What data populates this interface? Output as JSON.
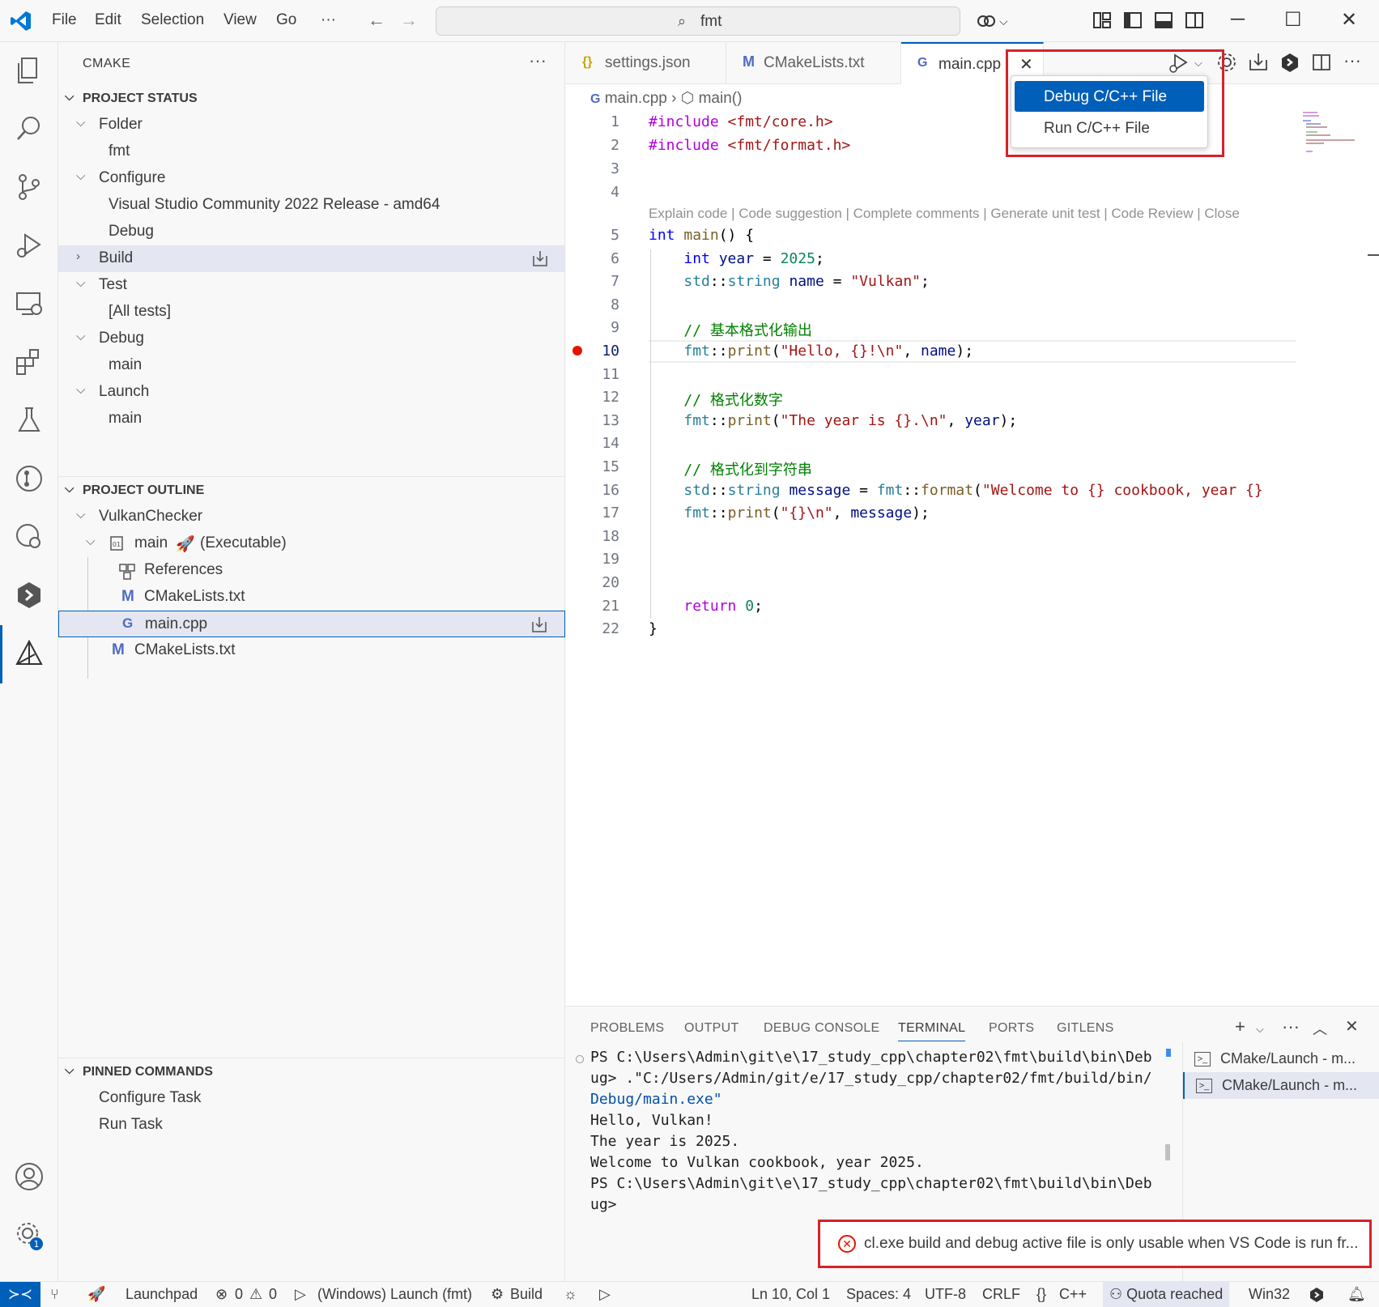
{
  "titlebar": {
    "menus": [
      "File",
      "Edit",
      "Selection",
      "View",
      "Go",
      "···"
    ],
    "search_text": "fmt"
  },
  "sidebar": {
    "title": "CMAKE",
    "project_status": {
      "header": "PROJECT STATUS",
      "rows": [
        "Folder",
        "fmt",
        "Configure",
        "Visual Studio Community 2022 Release - amd64",
        "Debug",
        "Build",
        "Test",
        "[All tests]",
        "Debug",
        "main",
        "Launch",
        "main"
      ]
    },
    "project_outline": {
      "header": "PROJECT OUTLINE",
      "rows": [
        "VulkanChecker",
        "main",
        "(Executable)",
        "References",
        "CMakeLists.txt",
        "main.cpp",
        "CMakeLists.txt"
      ]
    },
    "pinned_commands": {
      "header": "PINNED COMMANDS",
      "rows": [
        "Configure Task",
        "Run Task"
      ]
    }
  },
  "tabs": [
    {
      "label": "settings.json",
      "icon": "{}"
    },
    {
      "label": "CMakeLists.txt",
      "icon": "M"
    },
    {
      "label": "main.cpp",
      "icon": "G"
    }
  ],
  "editor": {
    "breadcrumb": [
      "main.cpp",
      "main()"
    ],
    "codelens": "Explain code | Code suggestion | Complete comments | Generate unit test | Code Review | Close",
    "line_numbers": [
      "1",
      "2",
      "3",
      "4",
      "5",
      "6",
      "7",
      "8",
      "9",
      "10",
      "11",
      "12",
      "13",
      "14",
      "15",
      "16",
      "17",
      "18",
      "19",
      "20",
      "21",
      "22"
    ],
    "current_line": "10"
  },
  "run_menu": {
    "items": [
      "Debug C/C++ File",
      "Run C/C++ File"
    ]
  },
  "panel": {
    "tabs": [
      "PROBLEMS",
      "OUTPUT",
      "DEBUG CONSOLE",
      "TERMINAL",
      "PORTS",
      "GITLENS"
    ],
    "terminal_lines": [
      "PS C:\\Users\\Admin\\git\\e\\17_study_cpp\\chapter02\\fmt\\build\\bin\\Deb",
      "ug> .\"C:/Users/Admin/git/e/17_study_cpp/chapter02/fmt/build/bin/",
      "Debug/main.exe\"",
      "Hello, Vulkan!",
      "The year is 2025.",
      "Welcome to Vulkan cookbook, year 2025.",
      "PS C:\\Users\\Admin\\git\\e\\17_study_cpp\\chapter02\\fmt\\build\\bin\\Deb",
      "ug>"
    ],
    "terminals": [
      "CMake/Launch - m...",
      "CMake/Launch - m..."
    ]
  },
  "notification": {
    "text": "cl.exe build and debug active file is only usable when VS Code is run fr..."
  },
  "statusbar": {
    "launchpad": "Launchpad",
    "errors": "0",
    "warnings": "0",
    "launch": "(Windows) Launch (fmt)",
    "build": "Build",
    "position": "Ln 10, Col 1",
    "spaces": "Spaces: 4",
    "encoding": "UTF-8",
    "eol": "CRLF",
    "language": "C++",
    "quota": "Quota reached",
    "platform": "Win32",
    "notification_count": "1"
  }
}
